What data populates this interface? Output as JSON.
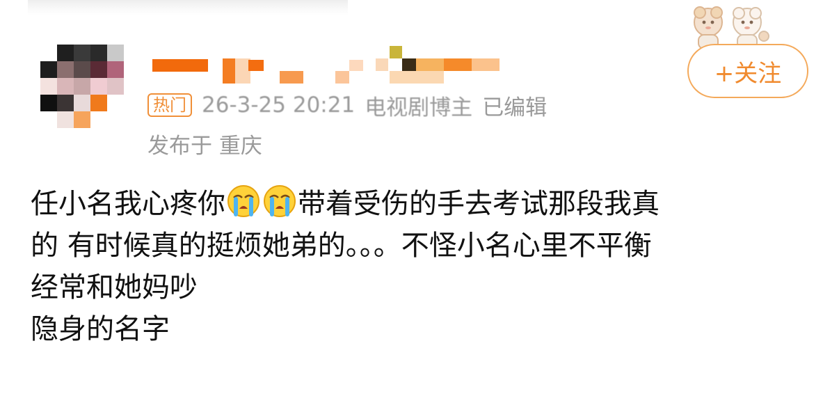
{
  "post": {
    "meta": {
      "badge": "热门",
      "datetime": "26-3-25 20:21",
      "role": "电视剧博主",
      "edited": "已编辑"
    },
    "location": "发布于 重庆",
    "follow_button": {
      "icon": "plus-icon",
      "label": "+关注"
    },
    "body": {
      "line1_before_emoji": "任小名我心疼你",
      "emojis": [
        "crying-face-emoji",
        "crying-face-emoji"
      ],
      "line1_after_emoji": "带着受伤的手去考试那段我真",
      "line2": "的 有时候真的挺烦她弟的。。。不怪小名心里不平衡",
      "line3": "经常和她妈吵",
      "line4": "隐身的名字"
    }
  },
  "colors": {
    "accent": "#f08a2e",
    "meta_text": "#9a9a9a",
    "body_text": "#111111"
  }
}
